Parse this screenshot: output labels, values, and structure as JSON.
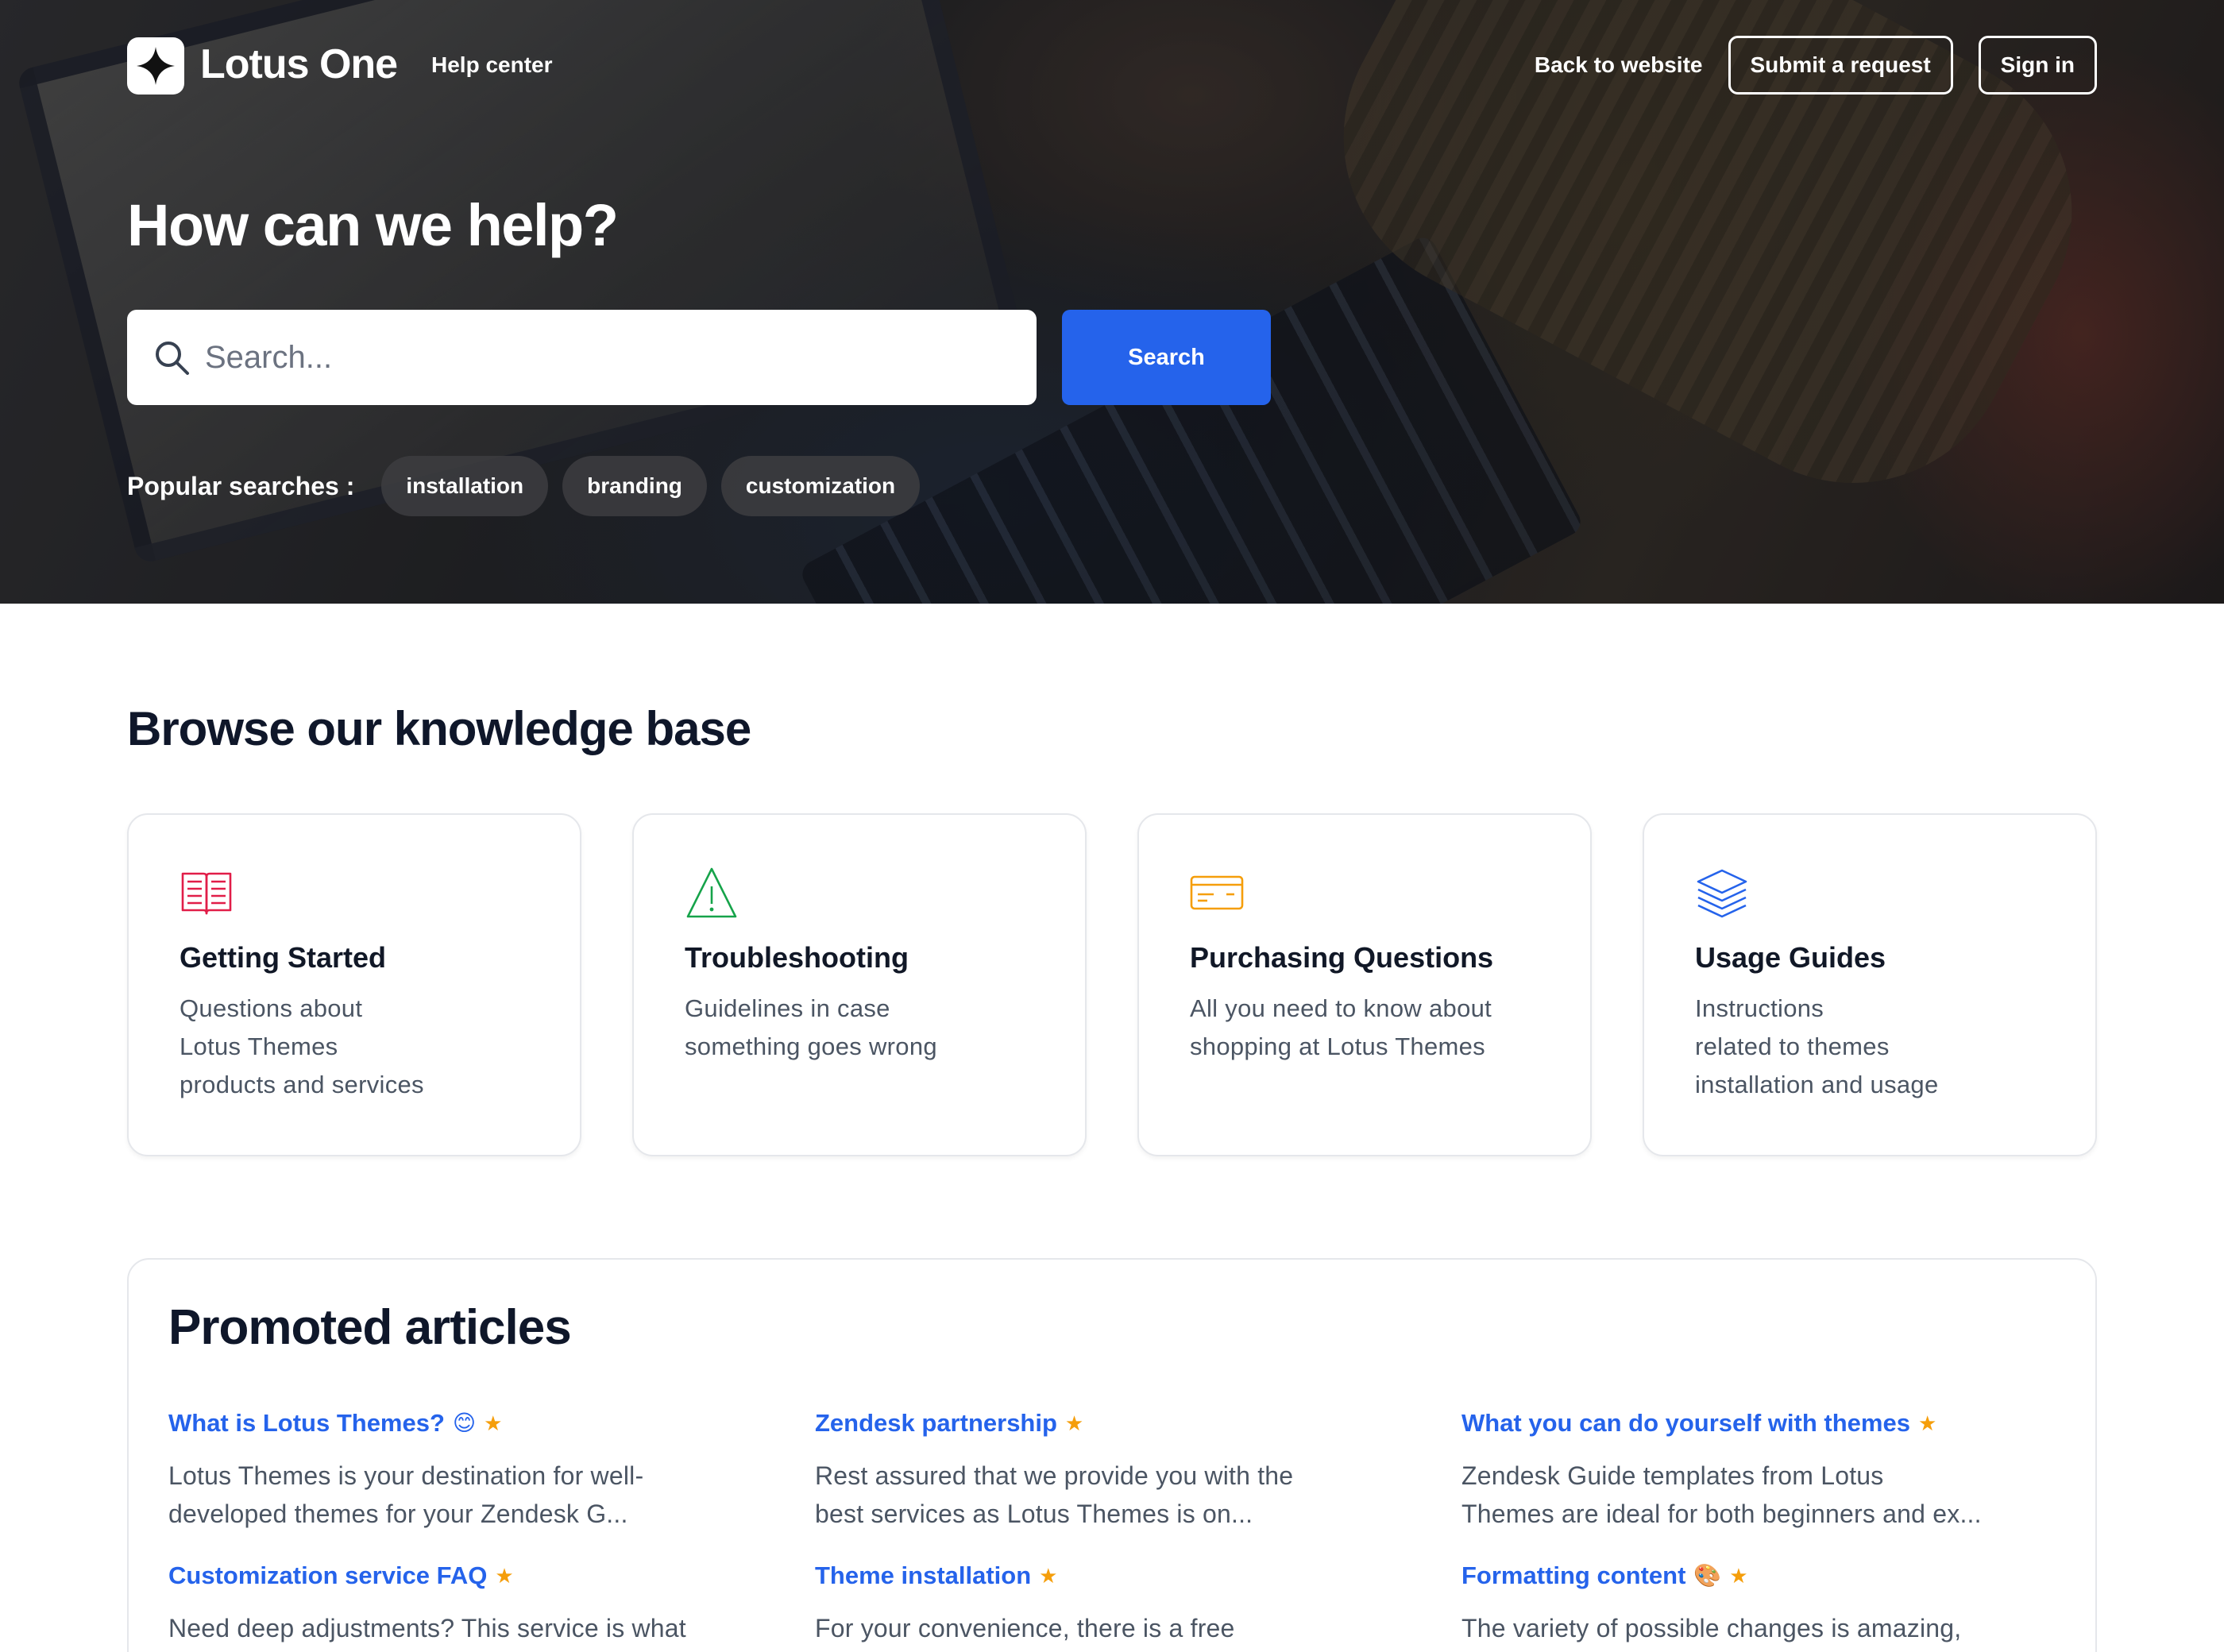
{
  "header": {
    "brand": "Lotus One",
    "subtitle": "Help center",
    "nav": {
      "back_link": "Back to website",
      "submit_request": "Submit a request",
      "sign_in": "Sign in"
    }
  },
  "hero": {
    "title": "How can we help?",
    "search": {
      "placeholder": "Search...",
      "value": "",
      "button": "Search"
    },
    "popular_label": "Popular searches :",
    "popular_chips": [
      "installation",
      "branding",
      "customization"
    ]
  },
  "knowledge_base": {
    "title": "Browse our knowledge base",
    "cards": [
      {
        "icon": "book-icon",
        "title": "Getting Started",
        "desc": [
          "Questions about",
          "Lotus Themes",
          "products and services"
        ],
        "color": "#e11d48"
      },
      {
        "icon": "warning-icon",
        "title": "Troubleshooting",
        "desc": [
          "Guidelines in case",
          "something goes wrong"
        ],
        "color": "#16a34a"
      },
      {
        "icon": "credit-card-icon",
        "title": "Purchasing Questions",
        "desc": [
          "All you need to know about",
          "shopping at Lotus Themes"
        ],
        "color": "#f59e0b"
      },
      {
        "icon": "layers-icon",
        "title": "Usage Guides",
        "desc": [
          "Instructions",
          "related to themes",
          "installation and usage"
        ],
        "color": "#2563eb"
      }
    ]
  },
  "promoted": {
    "title": "Promoted articles",
    "articles": [
      {
        "title": "What is Lotus Themes?",
        "emoji": "😊",
        "excerpt": [
          "Lotus Themes is your destination for well-",
          "developed themes for your Zendesk G..."
        ]
      },
      {
        "title": "Zendesk partnership",
        "emoji": "",
        "excerpt": [
          "Rest assured that we provide you with the",
          "best services as Lotus Themes is on..."
        ]
      },
      {
        "title": "What you can do yourself with themes",
        "emoji": "",
        "excerpt": [
          "Zendesk Guide templates from Lotus",
          "Themes are ideal for both beginners and ex..."
        ]
      },
      {
        "title": "Customization service FAQ",
        "emoji": "",
        "excerpt": [
          "Need deep adjustments? This service is what"
        ]
      },
      {
        "title": "Theme installation",
        "emoji": "",
        "excerpt": [
          "For your convenience, there is a free"
        ]
      },
      {
        "title": "Formatting content",
        "emoji": "🎨",
        "excerpt": [
          "The variety of possible changes is amazing,"
        ]
      }
    ],
    "star": "★"
  },
  "colors": {
    "accent": "#2563eb",
    "star": "#f59e0b",
    "heading": "#0f172a"
  }
}
